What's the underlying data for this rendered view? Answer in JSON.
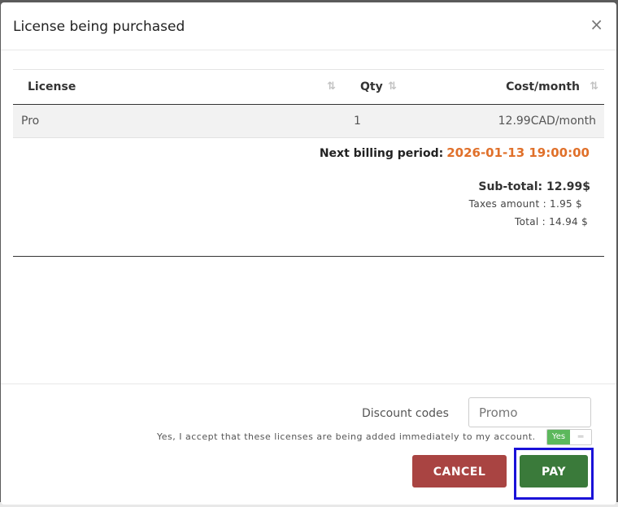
{
  "modal": {
    "title": "License being purchased",
    "close_glyph": "×"
  },
  "table": {
    "headers": {
      "license": "License",
      "qty": "Qty",
      "cost": "Cost/month"
    },
    "sort_icons": {
      "license": "⇅",
      "qty": "⇅",
      "cost": "⇅"
    },
    "rows": [
      {
        "license": "Pro",
        "qty": "1",
        "cost": "12.99CAD/month"
      }
    ]
  },
  "summary": {
    "billing_label": "Next billing period:",
    "billing_date": "2026-01-13 19:00:00",
    "subtotal": "Sub-total: 12.99$",
    "taxes": "Taxes amount : 1.95 $",
    "total": "Total : 14.94 $"
  },
  "footer": {
    "discount_label": "Discount codes",
    "promo_placeholder": "Promo",
    "accept_text": "Yes, I accept that these licenses are being added immediately to my account.",
    "toggle_on_label": "Yes",
    "toggle_handle": "═",
    "cancel_label": "CANCEL",
    "pay_label": "PAY"
  },
  "colors": {
    "accent_orange": "#e0702a",
    "cancel_red": "#a94442",
    "pay_green": "#3a7a3a",
    "toggle_green": "#5cb85c",
    "highlight_blue": "#1a12d8"
  }
}
